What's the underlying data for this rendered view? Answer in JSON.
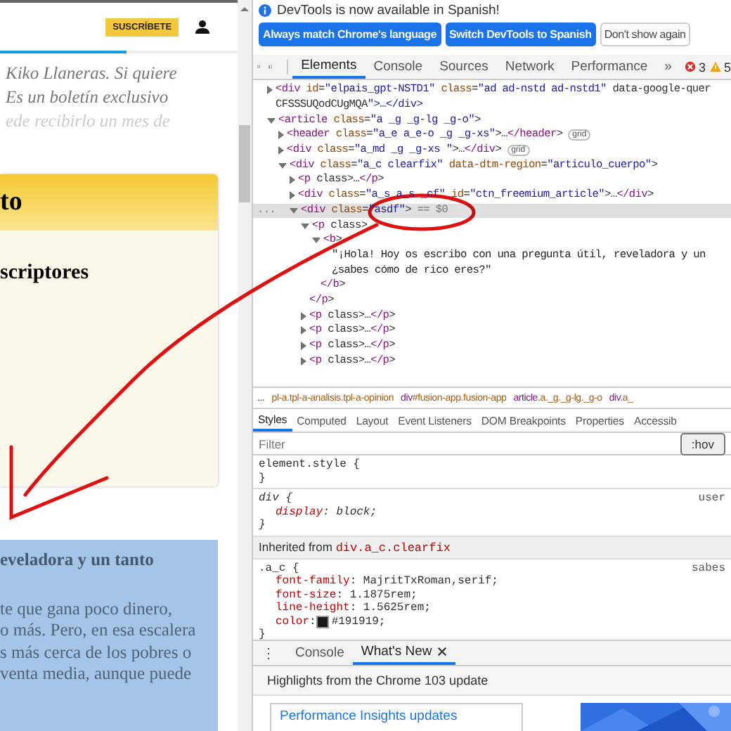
{
  "web_page": {
    "subscribe_button": "SUSCRÍBETE",
    "read_progress": {
      "level": 0.53
    },
    "lead_lines": [
      "Kiko Llaneras. Si quiere",
      "Es un boletín exclusivo",
      "ede recibirlo un mes de"
    ],
    "promo_box": {
      "title": "to",
      "subtitle": "scriptores"
    },
    "selected_excerpt": {
      "heading": "eveladora y un tanto",
      "lines": [
        "te que gana poco dinero,",
        "o más. Pero, en esa escalera",
        "s más cerca de los pobres o",
        "venta media, aunque puede"
      ]
    }
  },
  "devtools": {
    "infobar": {
      "message": "DevTools is now available in Spanish!",
      "buttons": [
        {
          "label": "Always match Chrome's language",
          "kind": "primary"
        },
        {
          "label": "Switch DevTools to Spanish",
          "kind": "primary"
        },
        {
          "label": "Don't show again",
          "kind": "plain"
        }
      ]
    },
    "tabs": [
      {
        "label": "Elements",
        "selected": true
      },
      {
        "label": "Console",
        "selected": false
      },
      {
        "label": "Sources",
        "selected": false
      },
      {
        "label": "Network",
        "selected": false
      },
      {
        "label": "Performance",
        "selected": false
      }
    ],
    "more_tabs": "»",
    "error_count": "3",
    "warning_count": "5",
    "dom_tree": [
      {
        "lines": [
          "<div id=\"elpais_gpt-NSTD1\" class=\"ad ad-nstd ad-nstd1\" data-google-quer",
          "CFSSSUQodCUgMQA\">…</div>"
        ],
        "expanded": false,
        "selected": false
      },
      {
        "lines": [
          "<article class=\"a _g _g-lg _g-o\">"
        ],
        "expanded": true,
        "selected": false,
        "children": [
          {
            "lines": [
              "<header class=\"a_e a_e-o _g _g-xs\">…</header>"
            ],
            "badge": "grid",
            "expanded": false,
            "selected": false
          },
          {
            "lines": [
              "<div class=\"a_md _g _g-xs \">…</div>"
            ],
            "badge": "grid",
            "expanded": false,
            "selected": false
          },
          {
            "lines": [
              "<div class=\"a_c clearfix\" data-dtm-region=\"articulo_cuerpo\">"
            ],
            "expanded": true,
            "selected": false,
            "children": [
              {
                "lines": [
                  "<p class>…</p>"
                ],
                "expanded": false,
                "selected": false
              },
              {
                "lines": [
                  "<div class=\"a_s a_s _cf\" id=\"ctn_freemium_article\">…</div>"
                ],
                "expanded": false,
                "selected": false
              },
              {
                "lines": [
                  "<div class=\"asdf\">"
                ],
                "suffix": "== $0",
                "gutter": "...",
                "expanded": true,
                "selected": true,
                "children": [
                  {
                    "lines": [
                      "<p class>"
                    ],
                    "closing": "</p>",
                    "expanded": true,
                    "selected": false,
                    "children": [
                      {
                        "lines": [
                          "<b>"
                        ],
                        "closing": "</b>",
                        "expanded": true,
                        "selected": false,
                        "children": [
                          {
                            "kind": "text",
                            "lines": [
                              "\"¡Hola! Hoy os escribo con una pregunta útil, reveladora y un",
                              "¿sabes cómo de rico eres?\""
                            ],
                            "selected": false
                          }
                        ]
                      }
                    ]
                  },
                  {
                    "lines": [
                      "<p class>…</p>"
                    ],
                    "expanded": false,
                    "selected": false
                  },
                  {
                    "lines": [
                      "<p class>…</p>"
                    ],
                    "expanded": false,
                    "selected": false
                  },
                  {
                    "lines": [
                      "<p class>…</p>"
                    ],
                    "expanded": false,
                    "selected": false
                  },
                  {
                    "lines": [
                      "<p class>…</p>"
                    ],
                    "expanded": false,
                    "selected": false
                  }
                ]
              }
            ]
          }
        ]
      }
    ],
    "breadcrumbs": {
      "overflow": "...",
      "items": [
        {
          "rest": "pl-a.tpl-a-analisis.tpl-a-opinion"
        },
        {
          "tag": "div",
          "rest": "#fusion-app.fusion-app"
        },
        {
          "tag": "article",
          "rest": ".a._g._g-lg._g-o"
        },
        {
          "tag": "div",
          "rest": ".a_"
        }
      ]
    },
    "style_tabs": [
      {
        "label": "Styles",
        "selected": true
      },
      {
        "label": "Computed",
        "selected": false
      },
      {
        "label": "Layout",
        "selected": false
      },
      {
        "label": "Event Listeners",
        "selected": false
      },
      {
        "label": "DOM Breakpoints",
        "selected": false
      },
      {
        "label": "Properties",
        "selected": false
      },
      {
        "label": "Accessib",
        "selected": false
      }
    ],
    "filter": {
      "placeholder": "Filter",
      "hov": ":hov"
    },
    "style_sections": [
      {
        "kind": "rule",
        "selector": "element.style {",
        "close": "}"
      },
      {
        "kind": "rule",
        "selector": "div {",
        "user_agent": true,
        "source": "user",
        "close": "}",
        "declarations": [
          {
            "text": "display: block;"
          }
        ]
      },
      {
        "kind": "inherited",
        "label": "Inherited from",
        "element": "div.a_c.clearfix"
      },
      {
        "kind": "rule",
        "selector": ".a_c {",
        "source": "sabes",
        "close": "}",
        "declarations": [
          {
            "text": "font-family: MajritTxRoman,serif;"
          },
          {
            "text": "font-size: 1.1875rem;"
          },
          {
            "text": "line-height: 1.5625rem;"
          },
          {
            "text": "color: #191919;",
            "color": "#191919"
          }
        ]
      }
    ],
    "drawer": {
      "menu": "⋮",
      "tabs": [
        {
          "label": "Console",
          "selected": false,
          "closable": false
        },
        {
          "label": "What's New",
          "selected": true,
          "closable": true
        }
      ],
      "headline": "Highlights from the Chrome 103 update",
      "card_title": "Performance Insights updates"
    }
  }
}
